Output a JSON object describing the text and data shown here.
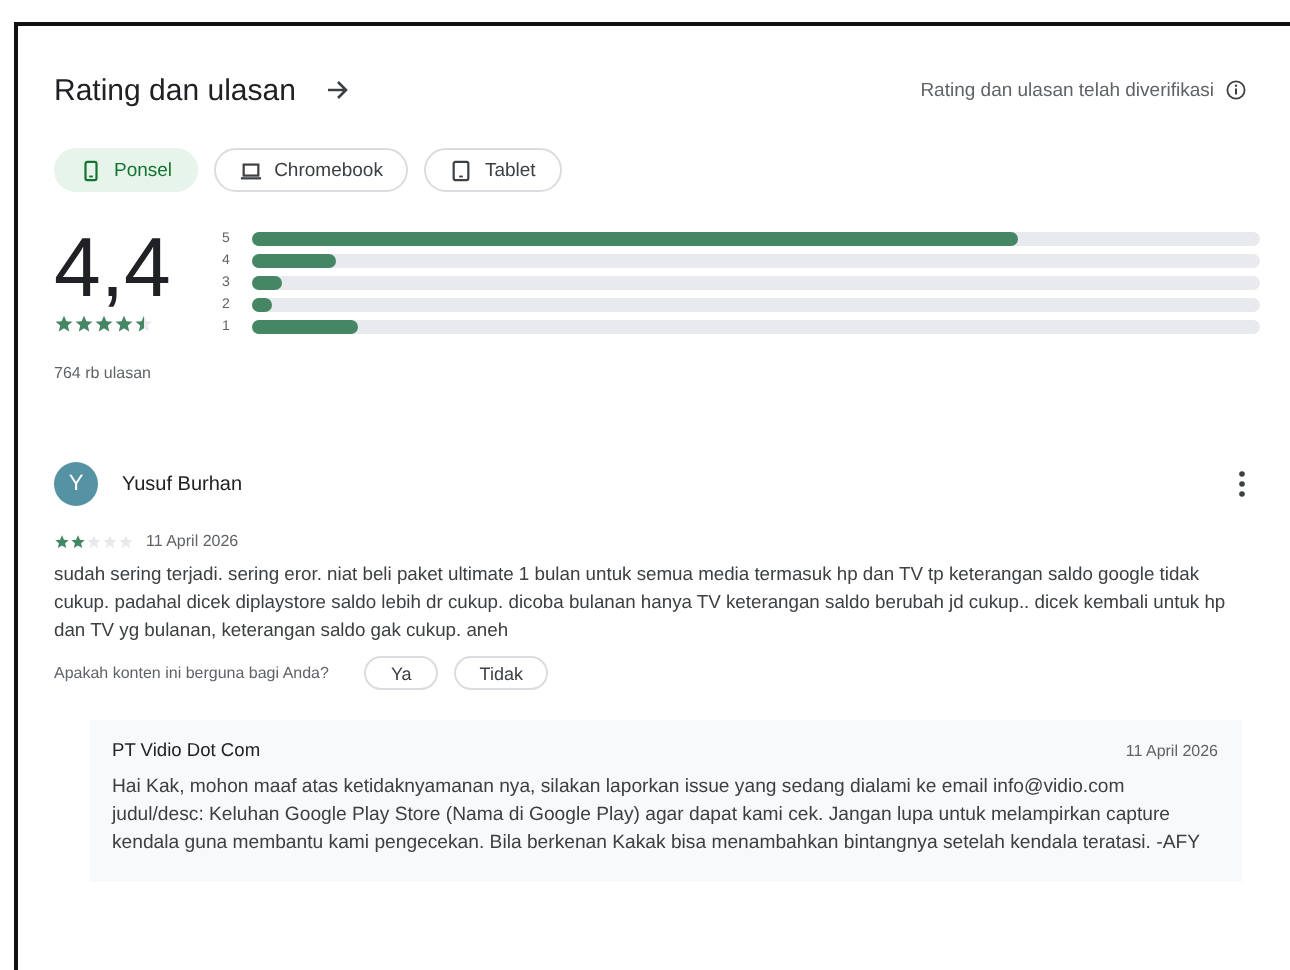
{
  "header": {
    "title": "Rating dan ulasan",
    "verified_note": "Rating dan ulasan telah diverifikasi"
  },
  "device_tabs": [
    {
      "label": "Ponsel",
      "kind": "phone",
      "selected": true
    },
    {
      "label": "Chromebook",
      "kind": "laptop",
      "selected": false
    },
    {
      "label": "Tablet",
      "kind": "tablet",
      "selected": false
    }
  ],
  "summary": {
    "score": "4,4",
    "stars": 4.5,
    "count": "764 rb ulasan",
    "bars": [
      {
        "label": "5",
        "level": 0.76
      },
      {
        "label": "4",
        "level": 0.083
      },
      {
        "label": "3",
        "level": 0.03
      },
      {
        "label": "2",
        "level": 0.02
      },
      {
        "label": "1",
        "level": 0.105
      }
    ]
  },
  "review": {
    "initial": "Y",
    "author": "Yusuf Burhan",
    "stars": 2,
    "date": "11 April 2026",
    "text": "sudah sering terjadi. sering eror. niat beli paket ultimate 1 bulan untuk semua media termasuk hp dan TV tp keterangan saldo google tidak cukup. padahal dicek diplaystore saldo lebih dr cukup. dicoba bulanan hanya TV keterangan saldo berubah jd cukup.. dicek kembali untuk hp dan TV yg bulanan, keterangan saldo gak cukup. aneh",
    "helpful_question": "Apakah konten ini berguna bagi Anda?",
    "helpful_buttons": [
      "Ya",
      "Tidak"
    ],
    "reply": {
      "author": "PT Vidio Dot Com",
      "date": "11 April 2026",
      "text": "Hai Kak, mohon maaf atas ketidaknyamanan nya, silakan laporkan issue yang sedang dialami ke email info@vidio.com judul/desc: Keluhan Google Play Store (Nama di Google Play) agar dapat kami cek. Jangan lupa untuk melampirkan capture kendala guna membantu kami pengecekan. Bila berkenan Kakak bisa menambahkan bintangnya setelah kendala teratasi. -AFY"
    }
  }
}
